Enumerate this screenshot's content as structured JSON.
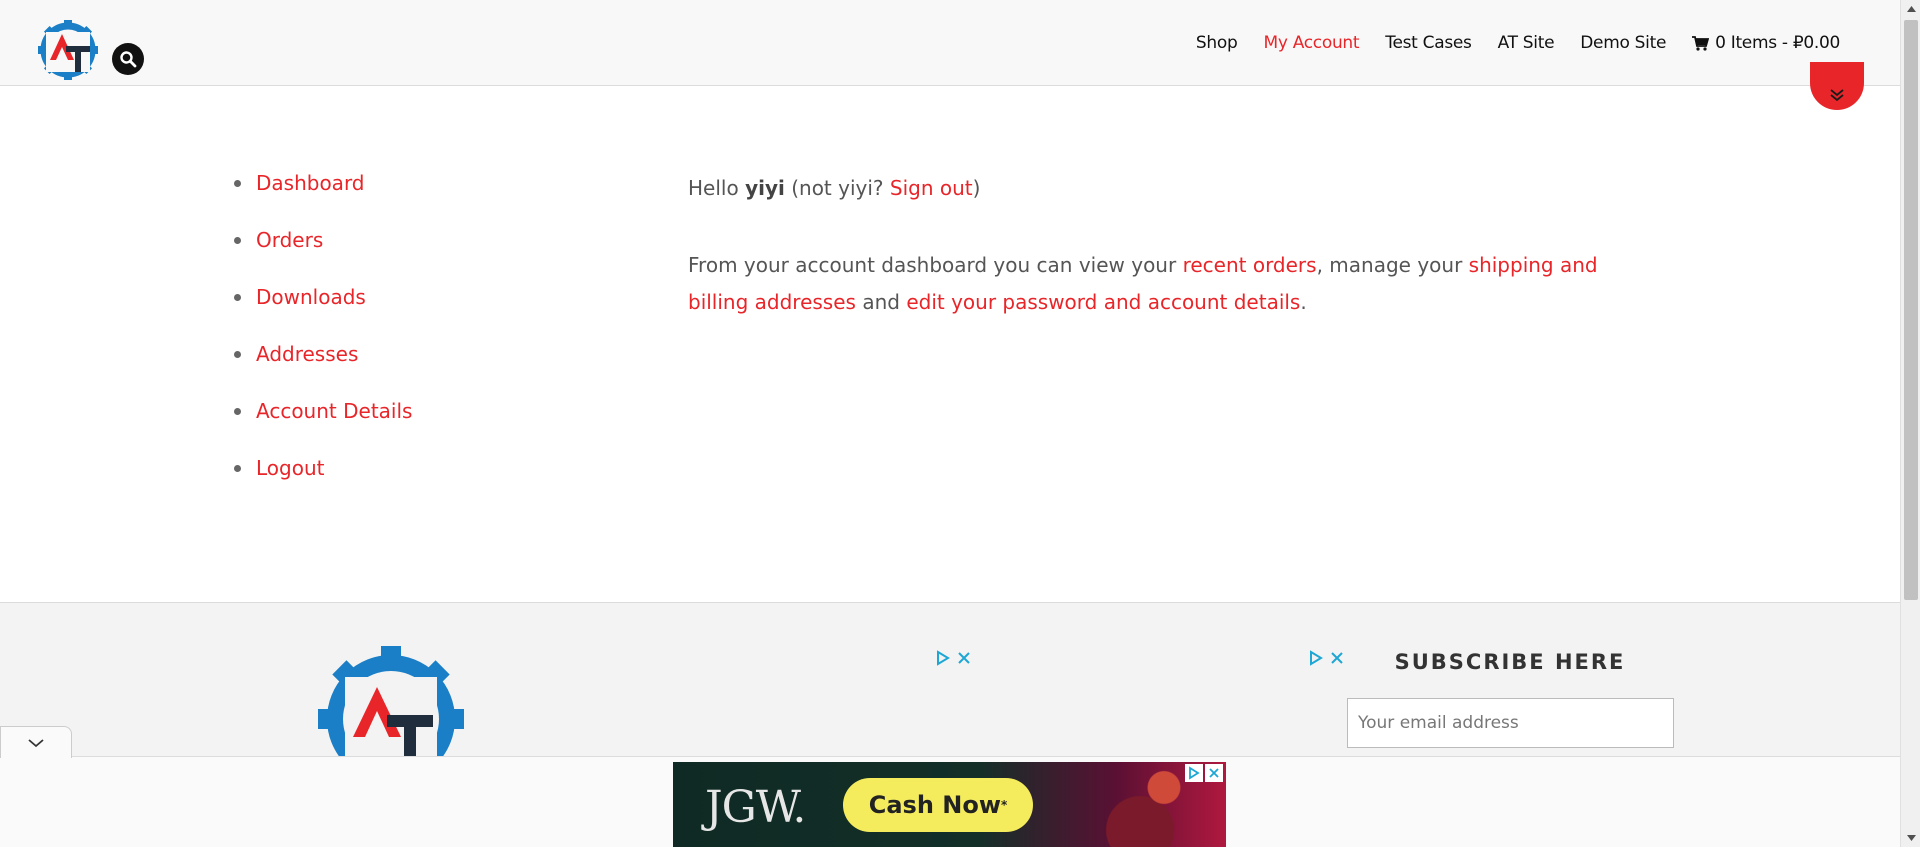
{
  "header": {
    "nav": [
      {
        "label": "Shop",
        "active": false
      },
      {
        "label": "My Account",
        "active": true
      },
      {
        "label": "Test Cases",
        "active": false
      },
      {
        "label": "AT Site",
        "active": false
      },
      {
        "label": "Demo Site",
        "active": false
      }
    ],
    "cart_label": "0 Items - ₽0.00",
    "logo_letters": "AT"
  },
  "account_nav": [
    "Dashboard",
    "Orders",
    "Downloads",
    "Addresses",
    "Account Details",
    "Logout"
  ],
  "content": {
    "hello": "Hello",
    "username": "yiyi",
    "not_user_prefix": "(not yiyi?",
    "sign_out": "Sign out",
    "not_user_suffix": ")",
    "dashboard_intro": "From your account dashboard you can view your",
    "recent_orders": "recent orders",
    "manage_text": ", manage your",
    "shipping_billing": "shipping and billing addresses",
    "and_text": "and",
    "edit_details": "edit your password and account details",
    "period": "."
  },
  "footer": {
    "subscribe_title": "SUBSCRIBE HERE",
    "email_placeholder": "Your email address"
  },
  "ad": {
    "brand": "JGW.",
    "cta": "Cash Now",
    "cta_mark": "*"
  },
  "colors": {
    "accent": "#e8262a",
    "logo_blue": "#1a7fc6",
    "logo_dark": "#1f2d3d",
    "ad_cta": "#f4ec5c"
  },
  "icons": {
    "search": "search-icon",
    "cart": "cart-icon",
    "scroll_down": "double-chevron-down-icon",
    "collapse": "chevron-down-icon",
    "adchoices": "adchoices-icon",
    "close": "close-icon"
  }
}
